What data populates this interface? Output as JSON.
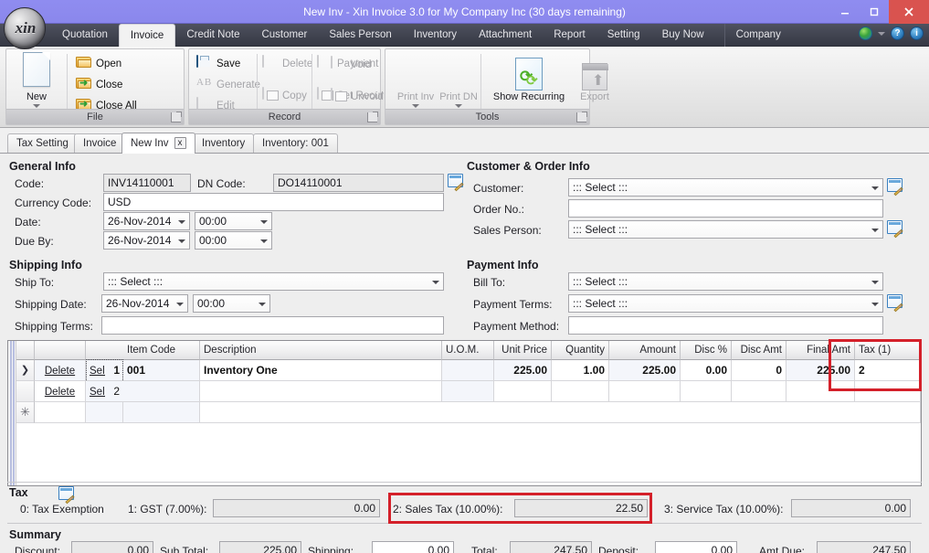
{
  "window": {
    "title": "New Inv - Xin Invoice 3.0 for My Company Inc (30 days remaining)",
    "minimize": "–",
    "maximize": "□",
    "close": "✕",
    "logo_text": "xin"
  },
  "menubar": {
    "items": [
      {
        "label": "Quotation",
        "active": false
      },
      {
        "label": "Invoice",
        "active": true
      },
      {
        "label": "Credit Note",
        "active": false
      },
      {
        "label": "Customer",
        "active": false
      },
      {
        "label": "Sales Person",
        "active": false
      },
      {
        "label": "Inventory",
        "active": false
      },
      {
        "label": "Attachment",
        "active": false
      },
      {
        "label": "Report",
        "active": false
      },
      {
        "label": "Setting",
        "active": false
      },
      {
        "label": "Buy Now",
        "active": false
      },
      {
        "label": "Company",
        "active": false
      }
    ],
    "help_label": "?",
    "info_label": "i"
  },
  "ribbon": {
    "groups": [
      {
        "name": "File",
        "label": "File"
      },
      {
        "name": "Record",
        "label": "Record"
      },
      {
        "name": "Tools",
        "label": "Tools"
      }
    ],
    "file": {
      "new": "New",
      "open": "Open",
      "close": "Close",
      "close_all": "Close All"
    },
    "record": {
      "save": "Save",
      "generate": "Generate",
      "edit": "Edit",
      "delete": "Delete",
      "copy": "Copy",
      "payment": "Payment",
      "set_recurring": "Set Recurring",
      "void": "Void",
      "unvoid": "Unvoid"
    },
    "tools": {
      "print_inv": "Print Inv",
      "print_dn": "Print DN",
      "show_recurring": "Show Recurring",
      "export": "Export"
    }
  },
  "doctabs": [
    {
      "label": "Tax Setting",
      "active": false,
      "closable": false
    },
    {
      "label": "Invoice",
      "active": false,
      "closable": false
    },
    {
      "label": "New Inv",
      "active": true,
      "closable": true,
      "close_label": "x"
    },
    {
      "label": "Inventory",
      "active": false,
      "closable": false
    },
    {
      "label": "Inventory: 001",
      "active": false,
      "closable": false
    }
  ],
  "general_info": {
    "title": "General Info",
    "code_label": "Code:",
    "code_value": "INV14110001",
    "dn_code_label": "DN Code:",
    "dn_code_value": "DO14110001",
    "currency_label": "Currency Code:",
    "currency_value": "USD",
    "date_label": "Date:",
    "date_value": "26-Nov-2014",
    "date_time_value": "00:00",
    "due_by_label": "Due By:",
    "due_by_value": "26-Nov-2014",
    "due_by_time_value": "00:00"
  },
  "customer_order_info": {
    "title": "Customer & Order Info",
    "customer_label": "Customer:",
    "customer_value": "::: Select :::",
    "order_no_label": "Order No.:",
    "order_no_value": "",
    "sales_person_label": "Sales Person:",
    "sales_person_value": "::: Select :::"
  },
  "shipping_info": {
    "title": "Shipping Info",
    "ship_to_label": "Ship To:",
    "ship_to_value": "::: Select :::",
    "shipping_date_label": "Shipping Date:",
    "shipping_date_value": "26-Nov-2014",
    "shipping_time_value": "00:00",
    "shipping_terms_label": "Shipping Terms:",
    "shipping_terms_value": ""
  },
  "payment_info": {
    "title": "Payment Info",
    "bill_to_label": "Bill To:",
    "bill_to_value": "::: Select :::",
    "payment_terms_label": "Payment Terms:",
    "payment_terms_value": "::: Select :::",
    "payment_method_label": "Payment Method:",
    "payment_method_value": ""
  },
  "grid": {
    "columns": [
      {
        "key": "delete",
        "label": ""
      },
      {
        "key": "select",
        "label": ""
      },
      {
        "key": "no",
        "label": "..."
      },
      {
        "key": "item_code",
        "label": "Item Code"
      },
      {
        "key": "description",
        "label": "Description"
      },
      {
        "key": "uom",
        "label": "U.O.M."
      },
      {
        "key": "unit_price",
        "label": "Unit Price"
      },
      {
        "key": "quantity",
        "label": "Quantity"
      },
      {
        "key": "amount",
        "label": "Amount"
      },
      {
        "key": "disc_pct",
        "label": "Disc %"
      },
      {
        "key": "disc_amt",
        "label": "Disc Amt"
      },
      {
        "key": "final_amt",
        "label": "Final Amt"
      },
      {
        "key": "tax1",
        "label": "Tax (1)"
      }
    ],
    "delete_label": "Delete",
    "select_label": "Select",
    "rows": [
      {
        "no": "1",
        "item_code": "001",
        "description": "Inventory One",
        "uom": "",
        "unit_price": "225.00",
        "quantity": "1.00",
        "amount": "225.00",
        "disc_pct": "0.00",
        "disc_amt": "0",
        "final_amt": "225.00",
        "tax1": "2",
        "current": true
      },
      {
        "no": "2",
        "item_code": "",
        "description": "",
        "uom": "",
        "unit_price": "",
        "quantity": "",
        "amount": "",
        "disc_pct": "",
        "disc_amt": "",
        "final_amt": "",
        "tax1": "",
        "current": false
      }
    ],
    "new_row_glyph": "✳"
  },
  "tax": {
    "title": "Tax",
    "exemption_label": "0: Tax Exemption",
    "gst_label": "1: GST (7.00%):",
    "gst_value": "0.00",
    "sales_tax_label": "2: Sales Tax (10.00%):",
    "sales_tax_value": "22.50",
    "service_tax_label": "3: Service Tax (10.00%):",
    "service_tax_value": "0.00"
  },
  "summary": {
    "title": "Summary",
    "discount_label": "Discount:",
    "discount_value": "0.00",
    "sub_total_label": "Sub Total:",
    "sub_total_value": "225.00",
    "shipping_label": "Shipping:",
    "shipping_value": "0.00",
    "total_label": "Total:",
    "total_value": "247.50",
    "deposit_label": "Deposit:",
    "deposit_value": "0.00",
    "amt_due_label": "Amt Due:",
    "amt_due_value": "247.50"
  },
  "colors": {
    "titlebar": "#8d8aee",
    "menubar": "#40434f",
    "highlight": "#d4202a",
    "close_button": "#d9534f"
  }
}
